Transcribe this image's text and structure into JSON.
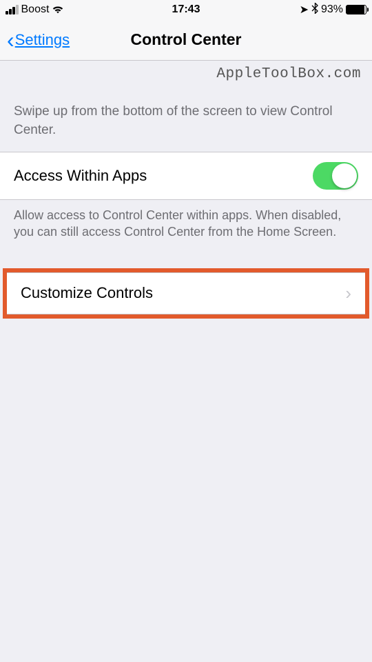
{
  "status": {
    "carrier": "Boost",
    "time": "17:43",
    "battery_pct": "93%"
  },
  "nav": {
    "back_label": "Settings",
    "title": "Control Center"
  },
  "watermark": "AppleToolBox.com",
  "section1_desc": "Swipe up from the bottom of the screen to view Control Center.",
  "access_row": {
    "label": "Access Within Apps",
    "enabled": true
  },
  "access_footer": "Allow access to Control Center within apps. When disabled, you can still access Control Center from the Home Screen.",
  "customize_row": {
    "label": "Customize Controls"
  }
}
